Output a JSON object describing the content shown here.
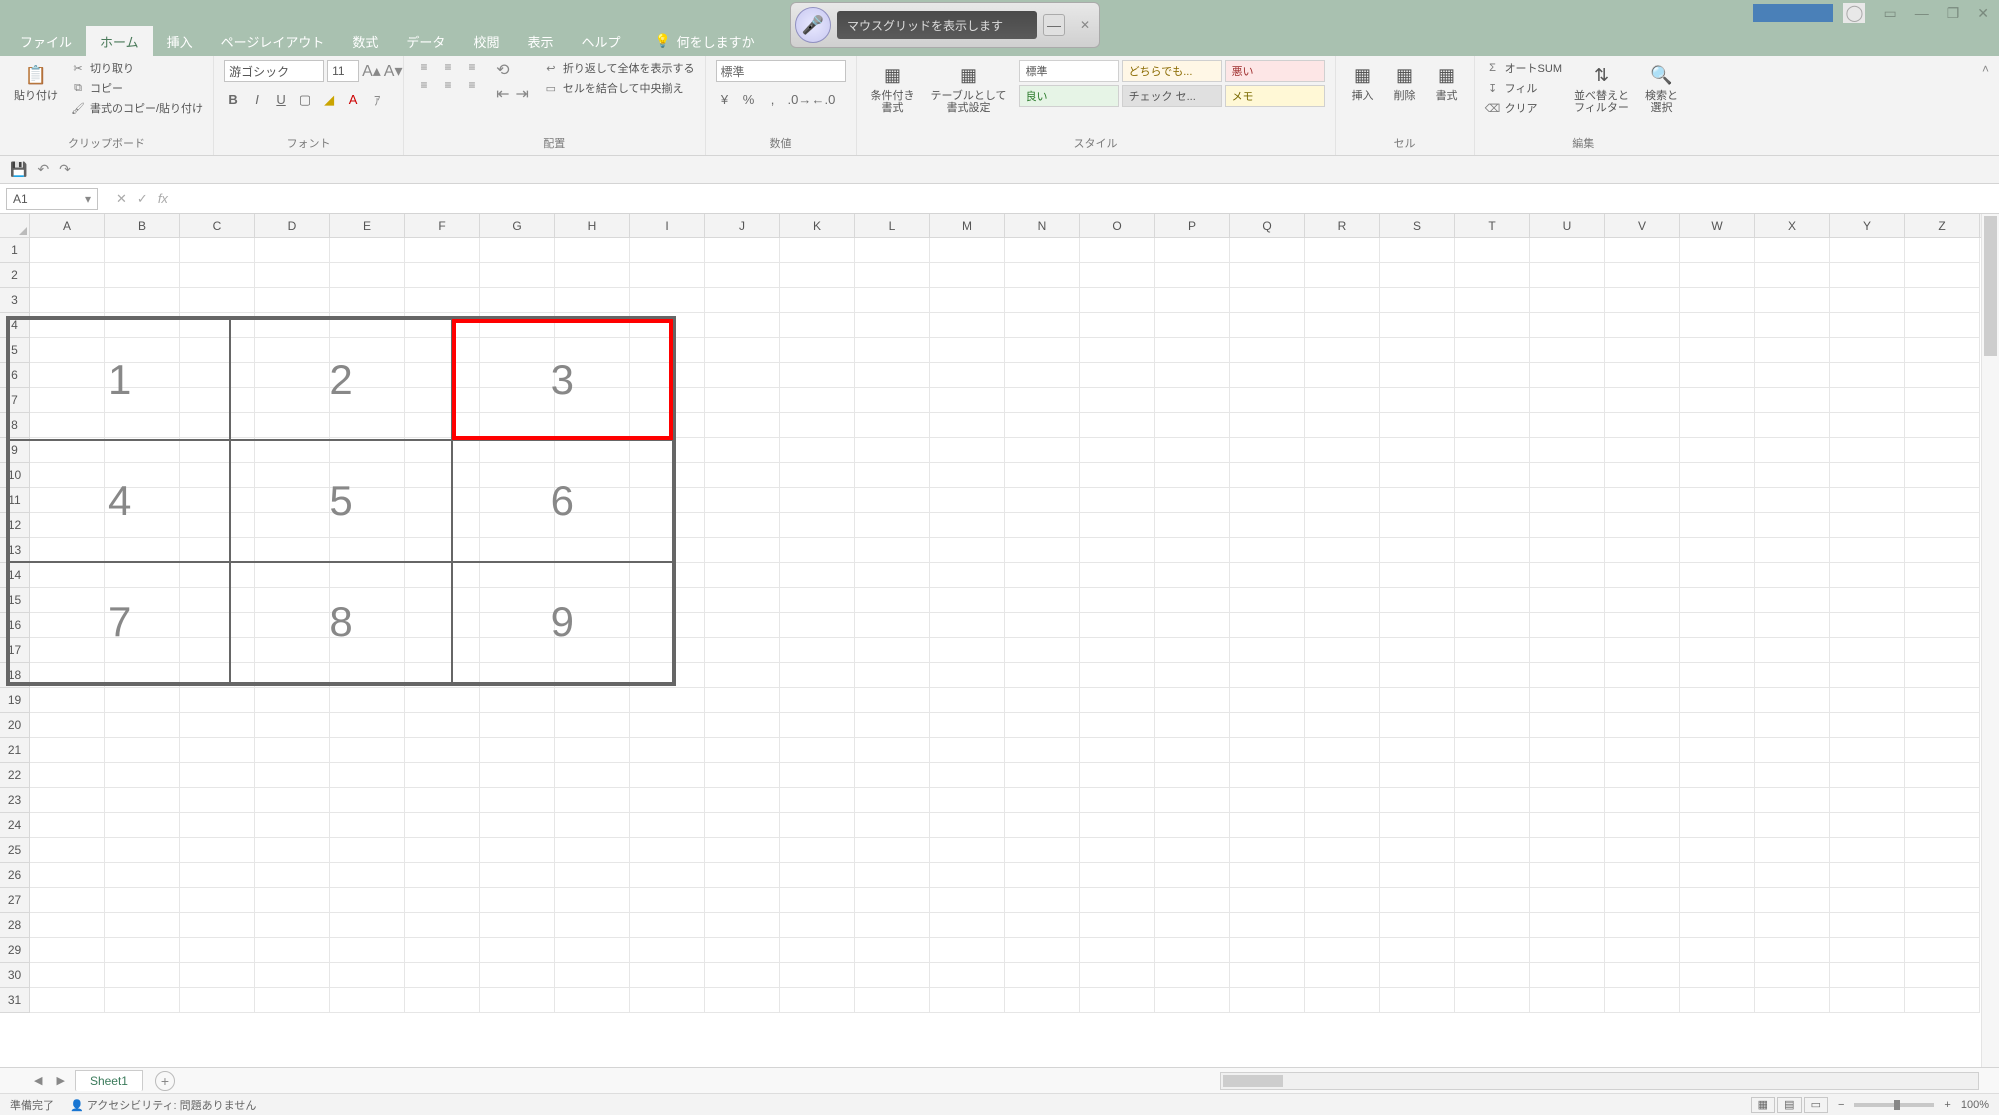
{
  "title_bar": {
    "minimize_tip": "—",
    "restore_tip": "❐",
    "close_tip": "✕",
    "ribbon_display_tip": "▭"
  },
  "voice_bar": {
    "message": "マウスグリッドを表示します",
    "minimize_glyph": "—",
    "close_glyph": "✕"
  },
  "tabs": {
    "file": "ファイル",
    "home": "ホーム",
    "insert": "挿入",
    "page_layout": "ページレイアウト",
    "formulas": "数式",
    "data": "データ",
    "review": "校閲",
    "view": "表示",
    "help": "ヘルプ",
    "tell_me": "何をしますか"
  },
  "ribbon": {
    "clipboard": {
      "paste": "貼り付け",
      "cut": "切り取り",
      "copy": "コピー",
      "format_painter": "書式のコピー/貼り付け",
      "label": "クリップボード"
    },
    "font": {
      "name": "游ゴシック",
      "size": "11",
      "label": "フォント"
    },
    "alignment": {
      "wrap": "折り返して全体を表示する",
      "merge": "セルを結合して中央揃え",
      "label": "配置"
    },
    "number": {
      "format": "標準",
      "label": "数値"
    },
    "styles": {
      "conditional": "条件付き\n書式",
      "format_table": "テーブルとして\n書式設定",
      "normal_cell": "標準",
      "neutral_cell": "どちらでも...",
      "bad_cell": "悪い",
      "good_cell": "良い",
      "check_cell": "チェック セ...",
      "memo_cell": "メモ",
      "label": "スタイル"
    },
    "cells": {
      "insert": "挿入",
      "delete": "削除",
      "format": "書式",
      "label": "セル"
    },
    "editing": {
      "autosum": "オートSUM",
      "fill": "フィル",
      "clear": "クリア",
      "sort": "並べ替えと\nフィルター",
      "find": "検索と\n選択",
      "label": "編集"
    }
  },
  "formula_bar": {
    "name_box": "A1",
    "cancel": "✕",
    "enter": "✓",
    "fx": "fx",
    "value": ""
  },
  "columns": [
    "A",
    "B",
    "C",
    "D",
    "E",
    "F",
    "G",
    "H",
    "I",
    "J",
    "K",
    "L",
    "M",
    "N",
    "O",
    "P",
    "Q",
    "R",
    "S",
    "T",
    "U",
    "V",
    "W",
    "X",
    "Y",
    "Z"
  ],
  "rows_count": 31,
  "mouse_grid_numbers": [
    "1",
    "2",
    "3",
    "4",
    "5",
    "6",
    "7",
    "8",
    "9"
  ],
  "sheet_tabs": {
    "active": "Sheet1"
  },
  "status_bar": {
    "ready": "準備完了",
    "accessibility": "アクセシビリティ: 問題ありません",
    "zoom": "100%",
    "zoom_minus": "−",
    "zoom_plus": "+"
  }
}
